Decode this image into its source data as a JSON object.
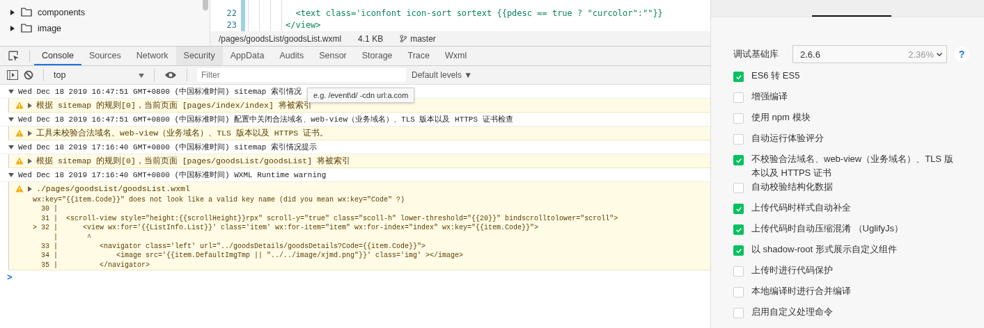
{
  "file_tree": {
    "items": [
      {
        "label": "components",
        "expanded": false
      },
      {
        "label": "image",
        "expanded": false
      }
    ]
  },
  "editor": {
    "lines": [
      {
        "number": "22",
        "code": "  <text class='iconfont icon-sort sortext {{pdesc == true ? \"curcolor\":\"\"}}"
      },
      {
        "number": "23",
        "code": "</view>"
      }
    ],
    "status": {
      "path": "/pages/goodsList/goodsList.wxml",
      "size": "4.1 KB",
      "branch": "master"
    }
  },
  "devtools_tabs": [
    {
      "label": "Console",
      "selected": true,
      "hovered": false
    },
    {
      "label": "Sources",
      "selected": false,
      "hovered": false
    },
    {
      "label": "Network",
      "selected": false,
      "hovered": false
    },
    {
      "label": "Security",
      "selected": false,
      "hovered": true
    },
    {
      "label": "AppData",
      "selected": false,
      "hovered": false
    },
    {
      "label": "Audits",
      "selected": false,
      "hovered": false
    },
    {
      "label": "Sensor",
      "selected": false,
      "hovered": false
    },
    {
      "label": "Storage",
      "selected": false,
      "hovered": false
    },
    {
      "label": "Trace",
      "selected": false,
      "hovered": false
    },
    {
      "label": "Wxml",
      "selected": false,
      "hovered": false
    }
  ],
  "toolbar": {
    "context": "top",
    "filter": {
      "placeholder": "Filter"
    },
    "levels": "Default levels ▼"
  },
  "console": {
    "groups": [
      {
        "header": "Wed Dec 18 2019 16:47:51 GMT+0800 (中国标准时间) sitemap 索引情况",
        "expanded": true,
        "messages": [
          {
            "kind": "warning",
            "text": "根据 sitemap 的规则[0]，当前页面 [pages/index/index] 将被索引"
          }
        ]
      },
      {
        "header": "Wed Dec 18 2019 16:47:51 GMT+0800 (中国标准时间) 配置中关闭合法域名、web-view（业务域名）、TLS 版本以及 HTTPS 证书检查",
        "expanded": true,
        "messages": [
          {
            "kind": "warning",
            "text": "工具未校验合法域名、web-view（业务域名）、TLS 版本以及 HTTPS 证书。"
          }
        ]
      },
      {
        "header": "Wed Dec 18 2019 17:16:40 GMT+0800 (中国标准时间) sitemap 索引情况提示",
        "expanded": true,
        "messages": [
          {
            "kind": "warning",
            "text": "根据 sitemap 的规则[0]，当前页面 [pages/goodsList/goodsList] 将被索引"
          }
        ]
      },
      {
        "header": "Wed Dec 18 2019 17:16:40 GMT+0800 (中国标准时间) WXML Runtime warning",
        "expanded": true,
        "messages": [
          {
            "kind": "warning",
            "text": "./pages/goodsList/goodsList.wxml",
            "details": [
              "wx:key=\"{{item.Code}}\" does not look like a valid key name (did you mean wx:key=\"Code\" ?)",
              "  30 |",
              "  31 |  <scroll-view style=\"height:{{scrollHeight}}rpx\" scroll-y=\"true\" class=\"scoll-h\" lower-threshold=\"{{20}}\" bindscrolltolower=\"scroll\">",
              "> 32 |      <view wx:for='{{ListInfo.List}}' class='item' wx:for-item=\"item\" wx:for-index=\"index\" wx:key=\"{{item.Code}}\">",
              "     |       ^",
              "  33 |          <navigator class='left' url=\"../goodsDetails/goodsDetails?Code={{item.Code}}\">",
              "  34 |              <image src='{{item.DefaultImgTmp || \"../../image/xjmd.png\"}}' class='img' ></image>",
              "  35 |          </navigator>"
            ]
          }
        ]
      }
    ],
    "prompt": ">"
  },
  "tooltip": "e.g. /event\\d/ -cdn url:a.com",
  "settings": {
    "library": {
      "label": "调试基础库",
      "value": "2.6.6",
      "share": "2.36%",
      "help": "?"
    },
    "options": [
      {
        "label": "ES6 转 ES5",
        "checked": true
      },
      {
        "label": "增强编译",
        "checked": false
      },
      {
        "label": "使用 npm 模块",
        "checked": false
      },
      {
        "label": "自动运行体验评分",
        "checked": false
      },
      {
        "label": "不校验合法域名、web-view（业务域名）、TLS 版本以及 HTTPS 证书",
        "checked": true
      },
      {
        "label": "自动校验结构化数据",
        "checked": false
      },
      {
        "label": "上传代码时样式自动补全",
        "checked": true
      },
      {
        "label": "上传代码时自动压缩混淆 （UglifyJs）",
        "checked": true
      },
      {
        "label": "以 shadow-root 形式展示自定义组件",
        "checked": true
      },
      {
        "label": "上传时进行代码保护",
        "checked": false
      },
      {
        "label": "本地编译时进行合并编译",
        "checked": false
      },
      {
        "label": "启用自定义处理命令",
        "checked": false
      }
    ]
  }
}
